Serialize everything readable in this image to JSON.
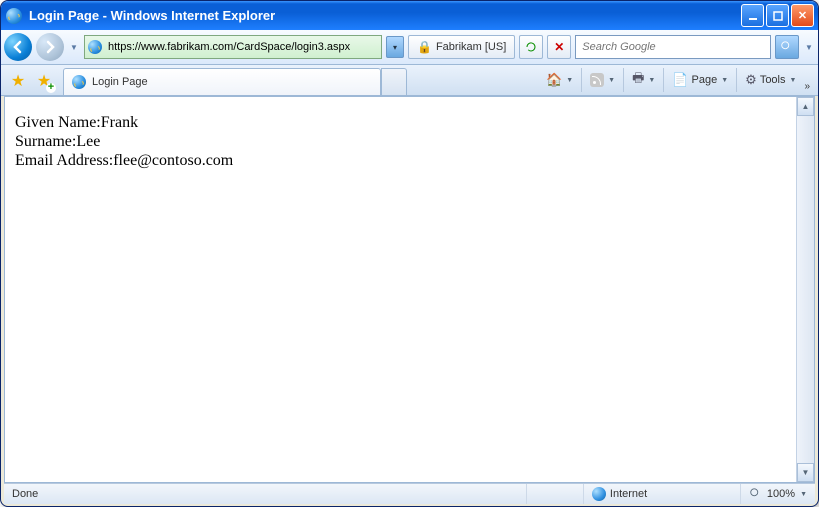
{
  "window": {
    "title": "Login Page - Windows Internet Explorer"
  },
  "nav": {
    "url": "https://www.fabrikam.com/CardSpace/login3.aspx",
    "identity": "Fabrikam [US]",
    "search_placeholder": "Search Google"
  },
  "tab": {
    "label": "Login Page"
  },
  "toolbar": {
    "page": "Page",
    "tools": "Tools"
  },
  "content": {
    "lines": [
      {
        "label": "Given Name:",
        "value": "Frank"
      },
      {
        "label": "Surname:",
        "value": "Lee"
      },
      {
        "label": "Email Address:",
        "value": "flee@contoso.com"
      }
    ]
  },
  "status": {
    "left": "Done",
    "zone": "Internet",
    "zoom": "100%"
  }
}
